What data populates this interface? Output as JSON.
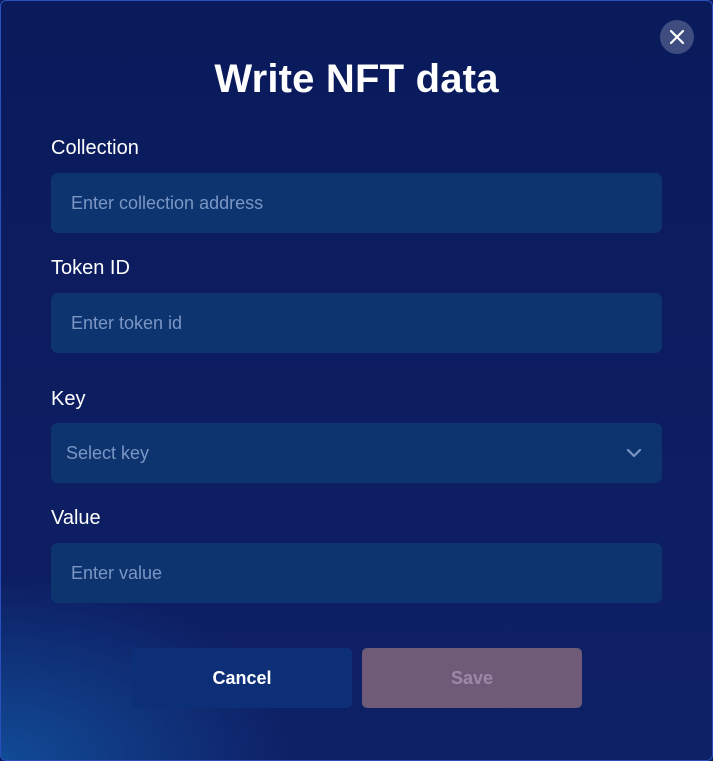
{
  "modal": {
    "title": "Write NFT data",
    "close_icon": "close-icon"
  },
  "fields": {
    "collection": {
      "label": "Collection",
      "placeholder": "Enter collection address",
      "value": ""
    },
    "token_id": {
      "label": "Token ID",
      "placeholder": "Enter token id",
      "value": ""
    },
    "key": {
      "label": "Key",
      "selected": "Select key",
      "icon": "chevron-down-icon"
    },
    "value": {
      "label": "Value",
      "placeholder": "Enter value",
      "value": ""
    }
  },
  "actions": {
    "cancel_label": "Cancel",
    "save_label": "Save"
  },
  "colors": {
    "background": "#0a1b5c",
    "field": "#0e3470",
    "placeholder": "#7a96c4",
    "cancel_button": "#0d2f78",
    "save_button_disabled": "#6f5a78"
  }
}
